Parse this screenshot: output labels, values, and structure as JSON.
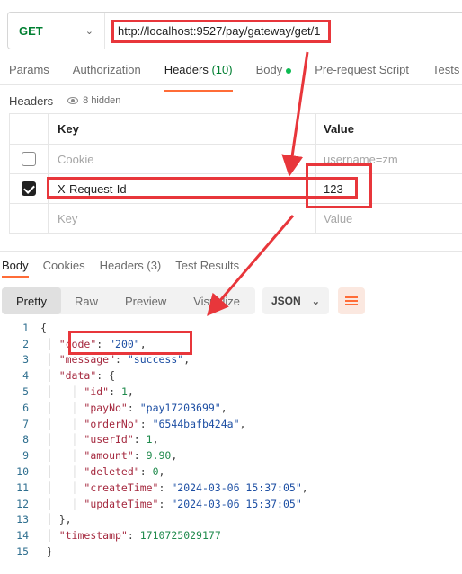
{
  "request": {
    "method": "GET",
    "url": "http://localhost:9527/pay/gateway/get/1"
  },
  "request_tabs": [
    {
      "label": "Params"
    },
    {
      "label": "Authorization"
    },
    {
      "label": "Headers",
      "count": "(10)"
    },
    {
      "label": "Body"
    },
    {
      "label": "Pre-request Script"
    },
    {
      "label": "Tests"
    }
  ],
  "headers_section": {
    "title": "Headers",
    "hidden_label": "8 hidden",
    "col_key": "Key",
    "col_value": "Value",
    "rows": [
      {
        "key": "Cookie",
        "value": "username=zm",
        "checked": false
      },
      {
        "key": "X-Request-Id",
        "value": "123",
        "checked": true
      }
    ],
    "placeholder_key": "Key",
    "placeholder_value": "Value"
  },
  "response_tabs": [
    {
      "label": "Body"
    },
    {
      "label": "Cookies"
    },
    {
      "label": "Headers",
      "count": "(3)"
    },
    {
      "label": "Test Results"
    }
  ],
  "view_modes": [
    "Pretty",
    "Raw",
    "Preview",
    "Visualize"
  ],
  "format": "JSON",
  "response_json": {
    "code": "\"200\"",
    "message": "\"success\"",
    "id": "1",
    "payNo": "\"pay17203699\"",
    "orderNo": "\"6544bafb424a\"",
    "userId": "1",
    "amount": "9.90",
    "deleted": "0",
    "createTime": "\"2024-03-06 15:37:05\"",
    "updateTime": "\"2024-03-06 15:37:05\"",
    "timestamp": "1710725029177"
  },
  "line_numbers": [
    "1",
    "2",
    "3",
    "4",
    "5",
    "6",
    "7",
    "8",
    "9",
    "10",
    "11",
    "12",
    "13",
    "14",
    "15"
  ],
  "colors": {
    "method": "#007f31",
    "accent": "#ff6c37",
    "annotation": "#e8363b"
  }
}
